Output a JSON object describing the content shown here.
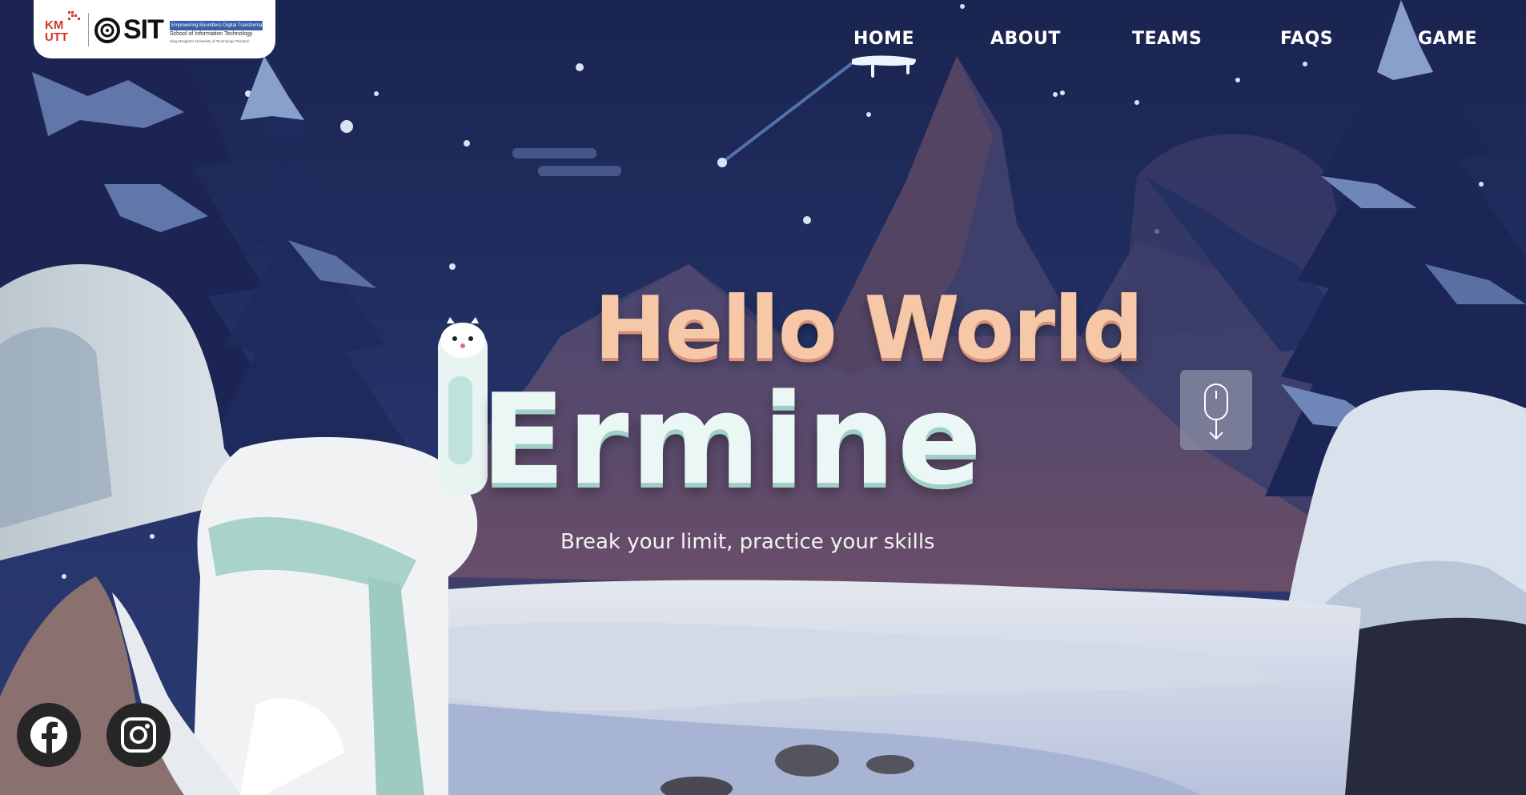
{
  "brand": {
    "kmutt_line1": "KM",
    "kmutt_line2": "UTT",
    "sit_name": "SIT",
    "sit_tagline": "Empowering Boundless Digital Transformation",
    "sit_school": "School of Information Technology",
    "sit_university": "King Mongkut's University of Technology Thonburi",
    "colors": {
      "kmutt_red": "#d33526",
      "sit_blue": "#3a5ea8"
    }
  },
  "nav": {
    "items": [
      {
        "label": "HOME",
        "active": true
      },
      {
        "label": "ABOUT"
      },
      {
        "label": "TEAMS"
      },
      {
        "label": "FAQS"
      },
      {
        "label": "GAME"
      }
    ]
  },
  "hero": {
    "title_line1": "Hello World",
    "title_line2": "Ermine",
    "tagline": "Break your limit, practice your skills",
    "scroll_icon": "mouse-scroll-down-icon"
  },
  "social": [
    {
      "icon": "facebook-icon"
    },
    {
      "icon": "instagram-icon"
    }
  ],
  "colors": {
    "sky_top": "#1a2450",
    "sky_mid": "#26346b",
    "title_peach": "#f6c8a8",
    "title_mint": "#eaf7f5",
    "snow": "#dde3ee"
  }
}
